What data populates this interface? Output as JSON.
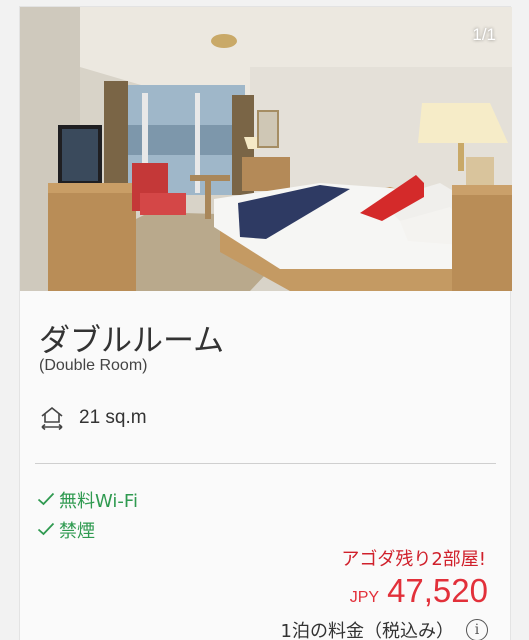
{
  "room": {
    "photo_counter": "1/1",
    "name": "ダブルルーム",
    "subtitle": "(Double Room)",
    "size": "21 sq.m"
  },
  "features": [
    {
      "label": "無料Wi-Fi",
      "icon": "check-icon"
    },
    {
      "label": "禁煙",
      "icon": "check-icon"
    }
  ],
  "pricing": {
    "rooms_left": "アゴダ残り2部屋!",
    "currency": "JPY",
    "amount": "47,520",
    "per_night_label": "1泊の料金（税込み）"
  },
  "colors": {
    "feature_green": "#2f9a50",
    "urgency_red": "#d0202b",
    "price_red": "#e2303a"
  }
}
